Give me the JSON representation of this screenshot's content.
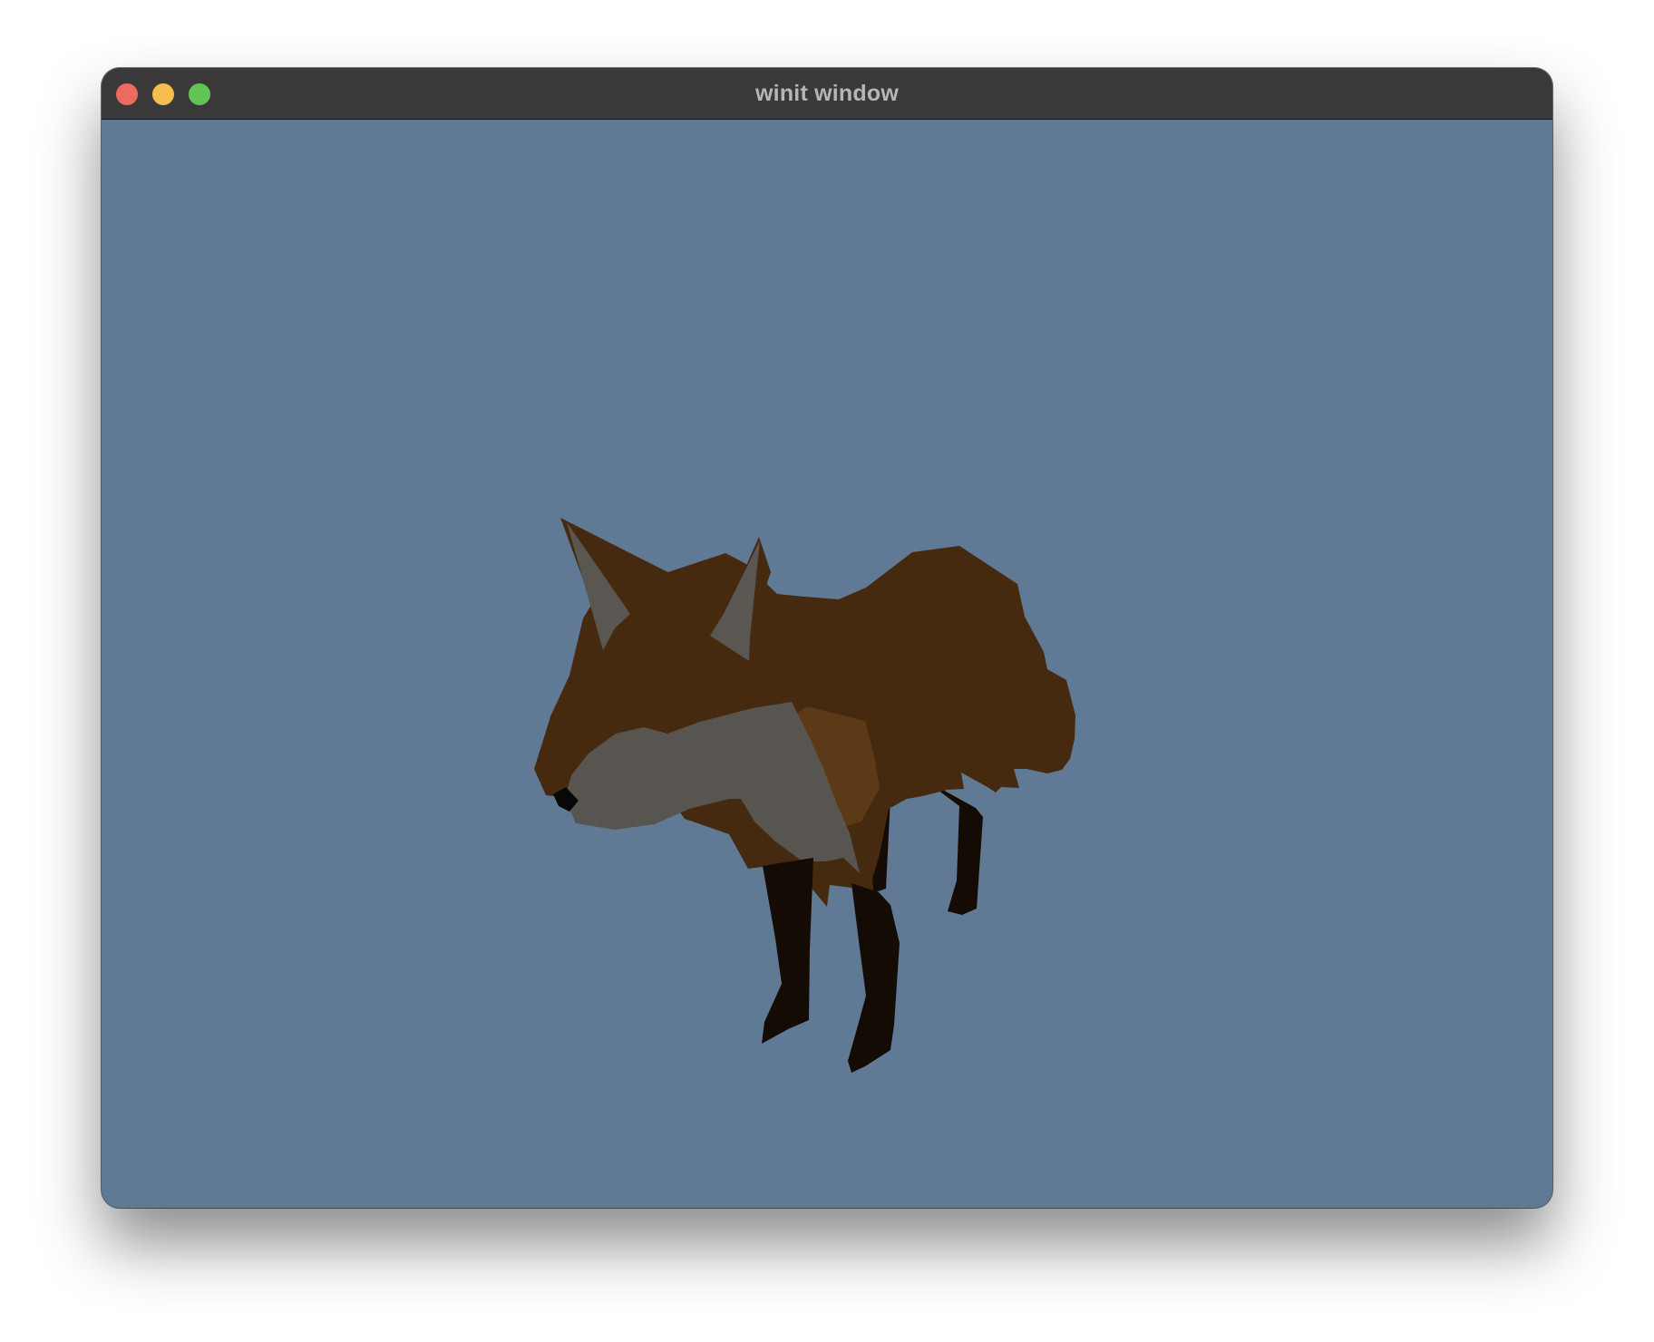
{
  "window": {
    "title": "winit window",
    "background_color": "#607a95"
  },
  "traffic_lights": {
    "close_color": "#ed6a5e",
    "minimize_color": "#f5be4f",
    "maximize_color": "#61c454"
  },
  "scene": {
    "model": "fox",
    "colors": {
      "fur": "#452a10",
      "fur_light": "#5c3a18",
      "ear_inner": "#5a5652",
      "muzzle": "#585551",
      "legs": "#140c04",
      "nose": "#0a0806"
    }
  }
}
